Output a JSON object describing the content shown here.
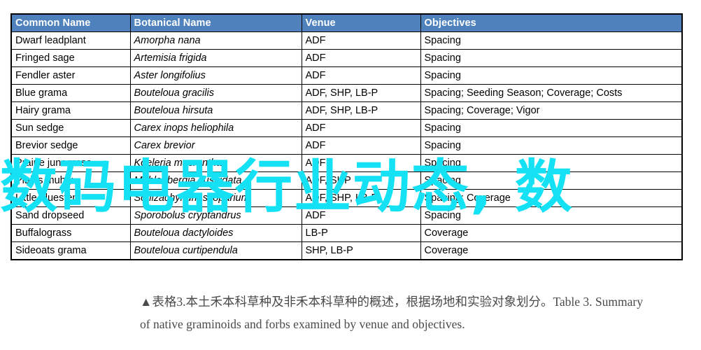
{
  "table": {
    "headers": [
      "Common Name",
      "Botanical  Name",
      "Venue",
      "Objectives"
    ],
    "header_bg_color": "#4f81bd",
    "header_text_color": "#ffffff",
    "rows": [
      {
        "common": "Dwarf leadplant",
        "botanical": "Amorpha nana",
        "venue": "ADF",
        "objectives": "Spacing"
      },
      {
        "common": "Fringed sage",
        "botanical": "Artemisia frigida",
        "venue": "ADF",
        "objectives": "Spacing"
      },
      {
        "common": "Fendler aster",
        "botanical": "Aster longifolius",
        "venue": "ADF",
        "objectives": "Spacing"
      },
      {
        "common": "Blue grama",
        "botanical": "Bouteloua gracilis",
        "venue": "ADF, SHP, LB-P",
        "objectives": "Spacing; Seeding Season;  Coverage; Costs"
      },
      {
        "common": "Hairy grama",
        "botanical": "Bouteloua hirsuta",
        "venue": "ADF, SHP, LB-P",
        "objectives": "Spacing; Coverage; Vigor"
      },
      {
        "common": "Sun sedge",
        "botanical": "Carex inops heliophila",
        "venue": "ADF",
        "objectives": "Spacing"
      },
      {
        "common": "Brevior sedge",
        "botanical": "Carex brevior",
        "venue": "ADF",
        "objectives": "Spacing"
      },
      {
        "common": "Prairie junegrass",
        "botanical": "Koeleria macrantha",
        "venue": "ADF",
        "objectives": "Spacing"
      },
      {
        "common": "Plains muhly",
        "botanical": "Muhlenbergia cuspidata",
        "venue": "ADF, SHP",
        "objectives": "Spacing"
      },
      {
        "common": "Little bluestem",
        "botanical": "Schizachyrium scoparium",
        "venue": "ADF, SHP, LB-P",
        "objectives": "Spacing; Coverage"
      },
      {
        "common": "Sand dropseed",
        "botanical": "Sporobolus cryptandrus",
        "venue": "ADF",
        "objectives": "Spacing"
      },
      {
        "common": "Buffalograss",
        "botanical": "Bouteloua dactyloides",
        "venue": "LB-P",
        "objectives": "Coverage"
      },
      {
        "common": "Sideoats grama",
        "botanical": "Bouteloua curtipendula",
        "venue": "SHP, LB-P",
        "objectives": "Coverage"
      }
    ]
  },
  "watermark": {
    "text": "数码电器行业动态, 数",
    "color": "#15e1f5"
  },
  "caption": {
    "line1": "▲表格3.本土禾本科草种及非禾本科草种的概述，根据场地和实验对象划分。Table 3. Summary",
    "line2": "of native graminoids and forbs examined by venue and objectives."
  }
}
